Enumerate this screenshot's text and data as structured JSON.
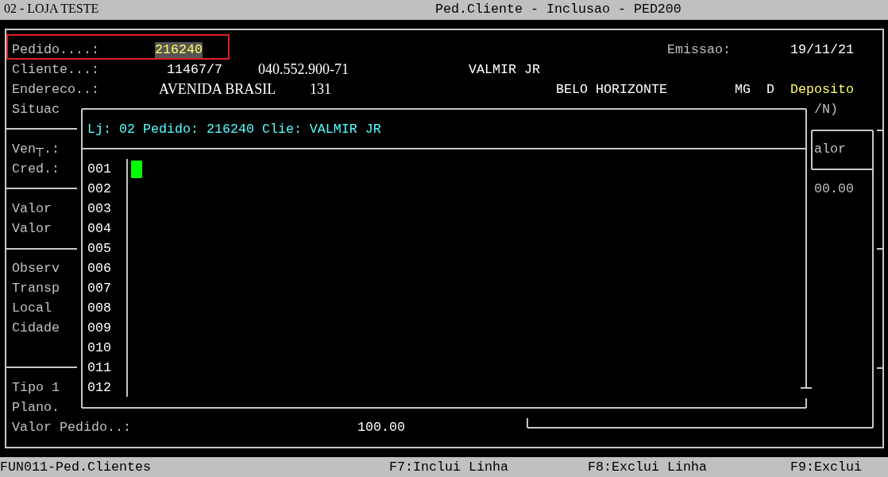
{
  "title_bar": {
    "store": "02 - LOJA TESTE",
    "title": "Ped.Cliente - Inclusao - PED200"
  },
  "pedido_highlighted": true,
  "screen_texts": [
    {
      "text": "Pedido....:",
      "kind": "label"
    },
    {
      "text": "216240",
      "kind": "focused"
    },
    {
      "text": "Emissao:",
      "kind": "label"
    },
    {
      "text": "19/11/21",
      "kind": "value"
    },
    {
      "text": "Cliente...:",
      "kind": "label"
    },
    {
      "text": "11467/7",
      "kind": "value"
    },
    {
      "text": "040.552.900-71",
      "kind": "serif"
    },
    {
      "text": "VALMIR JR",
      "kind": "value"
    },
    {
      "text": "Endereco..:",
      "kind": "label"
    },
    {
      "text": "AVENIDA BRASIL",
      "kind": "serif"
    },
    {
      "text": "131",
      "kind": "serif"
    },
    {
      "text": "BELO HORIZONTE",
      "kind": "value"
    },
    {
      "text": "MG",
      "kind": "value"
    },
    {
      "text": "D",
      "kind": "value"
    },
    {
      "text": "Deposito",
      "kind": "accent"
    },
    {
      "text": "Situac",
      "kind": "label"
    },
    {
      "text": "/N)",
      "kind": "label"
    },
    {
      "text": "Ven┬.:",
      "kind": "label"
    },
    {
      "text": "alor",
      "kind": "label"
    },
    {
      "text": "Cred.:",
      "kind": "label"
    },
    {
      "text": "00.00",
      "kind": "label"
    },
    {
      "text": "Valor",
      "kind": "label"
    },
    {
      "text": "Valor",
      "kind": "label"
    },
    {
      "text": "Observ",
      "kind": "label"
    },
    {
      "text": "Transp",
      "kind": "label"
    },
    {
      "text": "Local",
      "kind": "label"
    },
    {
      "text": "Cidade",
      "kind": "label"
    },
    {
      "text": "Tipo 1",
      "kind": "label"
    },
    {
      "text": "Plano.",
      "kind": "label"
    },
    {
      "text": "Valor Pedido..:",
      "kind": "label"
    },
    {
      "text": "100.00",
      "kind": "value"
    }
  ],
  "popup": {
    "header": "Lj: 02 Pedido: 216240 Clie: VALMIR JR",
    "line_numbers": [
      "001",
      "002",
      "003",
      "004",
      "005",
      "006",
      "007",
      "008",
      "009",
      "010",
      "011",
      "012"
    ]
  },
  "status_bar": {
    "program": "FUN011-Ped.Clientes",
    "keys": [
      "F7:Inclui Linha",
      "F8:Exclui Linha",
      "F9:Exclui"
    ]
  }
}
